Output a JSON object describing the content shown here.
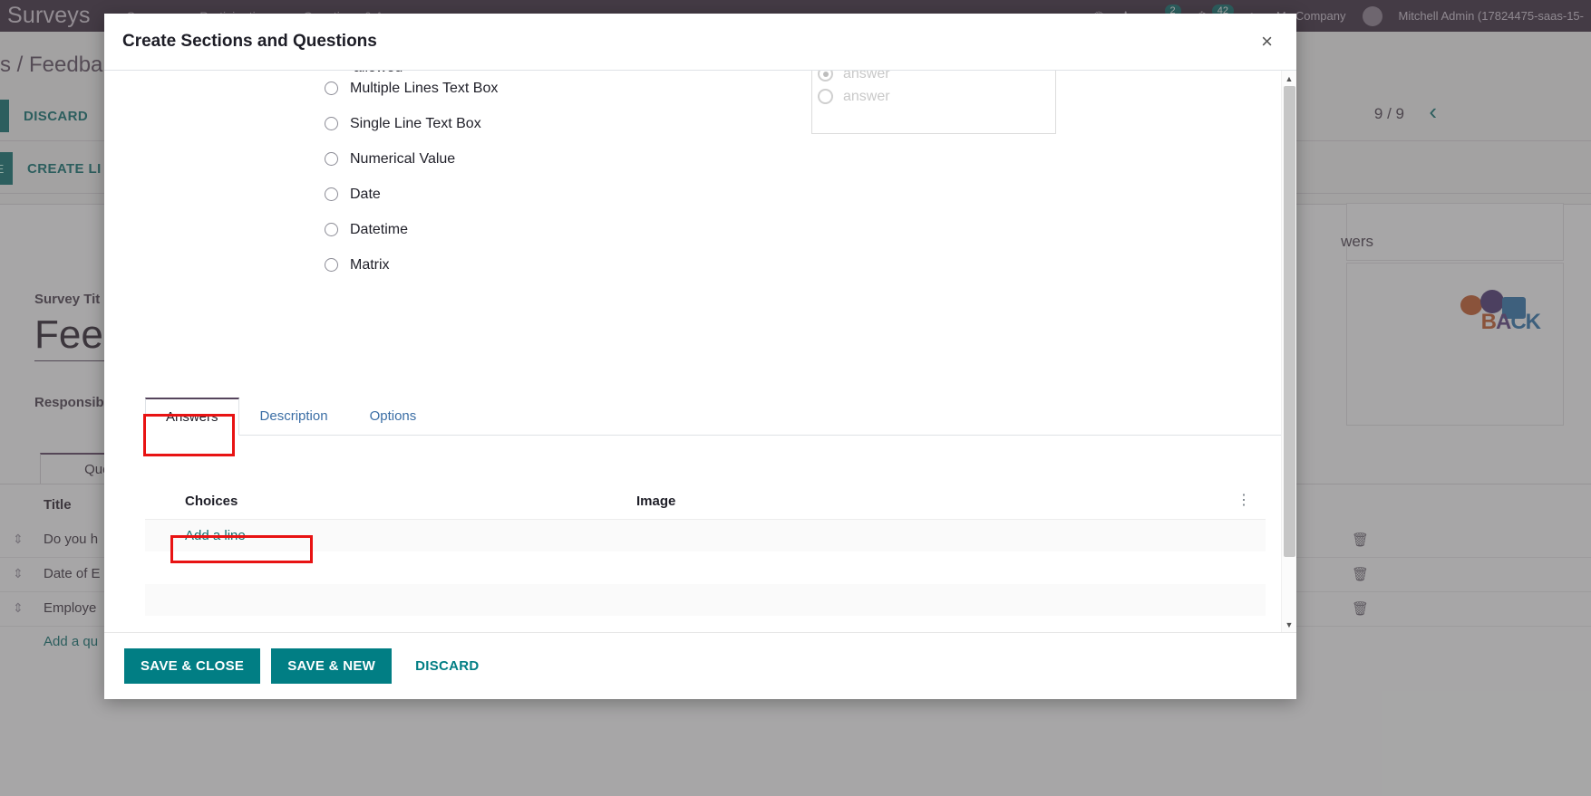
{
  "background": {
    "navbar": {
      "brand": "Surveys",
      "links": [
        "Surveys",
        "Participations",
        "Questions & Answers"
      ],
      "icons": [
        "crown-icon",
        "bug-icon",
        "messages-icon",
        "activity-icon",
        "shortcut-icon"
      ],
      "badges": [
        "2",
        "42"
      ],
      "company": "My Company",
      "user": "Mitchell Admin (17824475-saas-15-"
    },
    "breadcrumb": "ys / Feedba",
    "actions": {
      "discard": "DISCARD",
      "create_live": "CREATE LI"
    },
    "form": {
      "survey_title_label": "Survey Tit",
      "survey_title_value": "Feed",
      "responsible_label": "Responsibl",
      "tab_questions": "Questio",
      "column_title": "Title",
      "rows": [
        "Do you h",
        "Date of E",
        "Employe"
      ],
      "add_question": "Add a qu"
    },
    "pager": "9 / 9",
    "answers_label": "wers",
    "feedback_image_text": [
      "B",
      "A",
      "CK"
    ]
  },
  "modal": {
    "title": "Create Sections and Questions",
    "close_label": "×",
    "truncated_option": "allowed",
    "question_types": [
      "Multiple Lines Text Box",
      "Single Line Text Box",
      "Numerical Value",
      "Date",
      "Datetime",
      "Matrix"
    ],
    "preview": {
      "items": [
        {
          "label": "answer",
          "selected": true
        },
        {
          "label": "answer",
          "selected": false
        }
      ]
    },
    "tabs": [
      {
        "label": "Answers",
        "active": true,
        "highlighted": true
      },
      {
        "label": "Description",
        "active": false,
        "highlighted": false
      },
      {
        "label": "Options",
        "active": false,
        "highlighted": false
      }
    ],
    "table": {
      "columns": {
        "choices": "Choices",
        "image": "Image"
      },
      "options_icon": "⋮",
      "add_line": "Add a line"
    },
    "footer": {
      "save_close": "SAVE & CLOSE",
      "save_new": "SAVE & NEW",
      "discard": "DISCARD"
    }
  },
  "colors": {
    "accent_teal": "#017e84",
    "navbar_purple": "#3b2a3d",
    "highlight_red": "#e81313"
  }
}
